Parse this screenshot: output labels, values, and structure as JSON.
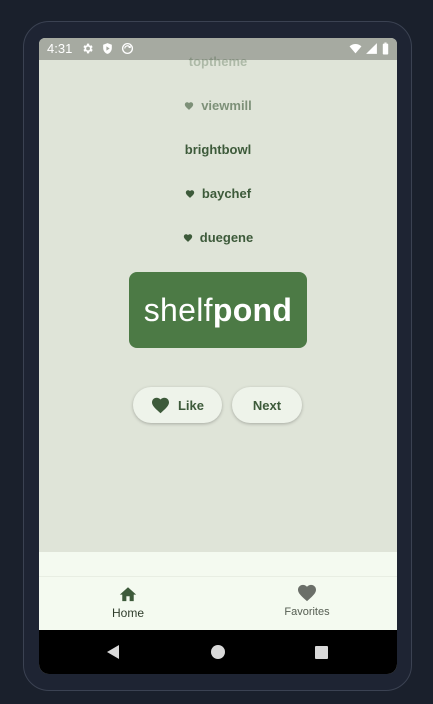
{
  "status_bar": {
    "time": "4:31",
    "left_icons": [
      "settings-icon",
      "play-protect-icon",
      "sync-icon"
    ],
    "right_icons": [
      "wifi-icon",
      "signal-icon",
      "battery-icon"
    ]
  },
  "history": [
    {
      "word": "toptheme",
      "liked": false,
      "faded": true
    },
    {
      "word": "viewmill",
      "liked": true,
      "faded": true
    },
    {
      "word": "brightbowl",
      "liked": false,
      "faded": false
    },
    {
      "word": "baychef",
      "liked": true,
      "faded": false
    },
    {
      "word": "duegene",
      "liked": true,
      "faded": false
    }
  ],
  "current_pair": {
    "first": "shelf",
    "second": "pond"
  },
  "actions": {
    "like_label": "Like",
    "next_label": "Next"
  },
  "bottom_nav": {
    "items": [
      {
        "label": "Home",
        "icon": "home-icon",
        "selected": true
      },
      {
        "label": "Favorites",
        "icon": "favorite-icon",
        "selected": false
      }
    ]
  },
  "colors": {
    "primary": "#4c7a45",
    "text_primary": "#3d5a3a",
    "surface": "#dfe4d8",
    "nav_bg": "#f4faf0"
  }
}
